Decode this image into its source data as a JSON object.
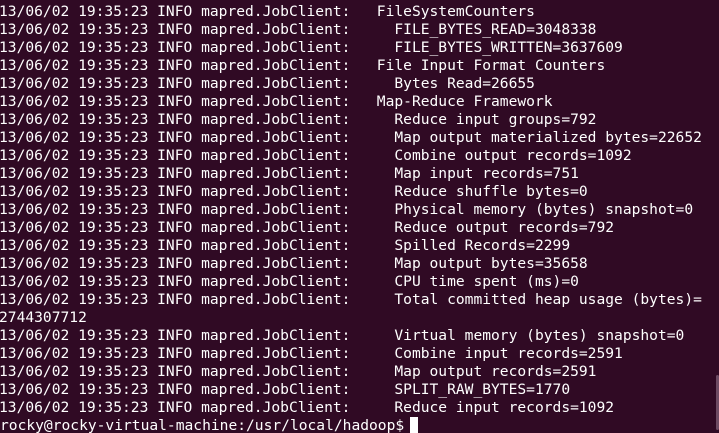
{
  "terminal": {
    "lines": [
      "13/06/02 19:35:23 INFO mapred.JobClient:   FileSystemCounters",
      "13/06/02 19:35:23 INFO mapred.JobClient:     FILE_BYTES_READ=3048338",
      "13/06/02 19:35:23 INFO mapred.JobClient:     FILE_BYTES_WRITTEN=3637609",
      "13/06/02 19:35:23 INFO mapred.JobClient:   File Input Format Counters",
      "13/06/02 19:35:23 INFO mapred.JobClient:     Bytes Read=26655",
      "13/06/02 19:35:23 INFO mapred.JobClient:   Map-Reduce Framework",
      "13/06/02 19:35:23 INFO mapred.JobClient:     Reduce input groups=792",
      "13/06/02 19:35:23 INFO mapred.JobClient:     Map output materialized bytes=22652",
      "13/06/02 19:35:23 INFO mapred.JobClient:     Combine output records=1092",
      "13/06/02 19:35:23 INFO mapred.JobClient:     Map input records=751",
      "13/06/02 19:35:23 INFO mapred.JobClient:     Reduce shuffle bytes=0",
      "13/06/02 19:35:23 INFO mapred.JobClient:     Physical memory (bytes) snapshot=0",
      "13/06/02 19:35:23 INFO mapred.JobClient:     Reduce output records=792",
      "13/06/02 19:35:23 INFO mapred.JobClient:     Spilled Records=2299",
      "13/06/02 19:35:23 INFO mapred.JobClient:     Map output bytes=35658",
      "13/06/02 19:35:23 INFO mapred.JobClient:     CPU time spent (ms)=0",
      "13/06/02 19:35:23 INFO mapred.JobClient:     Total committed heap usage (bytes)=",
      "2744307712",
      "13/06/02 19:35:23 INFO mapred.JobClient:     Virtual memory (bytes) snapshot=0",
      "13/06/02 19:35:23 INFO mapred.JobClient:     Combine input records=2591",
      "13/06/02 19:35:23 INFO mapred.JobClient:     Map output records=2591",
      "13/06/02 19:35:23 INFO mapred.JobClient:     SPLIT_RAW_BYTES=1770",
      "13/06/02 19:35:23 INFO mapred.JobClient:     Reduce input records=1092"
    ],
    "prompt": "rocky@rocky-virtual-machine:/usr/local/hadoop$",
    "colors": {
      "background": "#300a24",
      "foreground": "#ffffff"
    }
  }
}
